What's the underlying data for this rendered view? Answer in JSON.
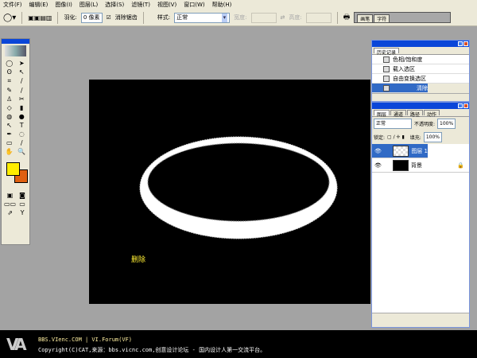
{
  "menu": [
    "文件(F)",
    "编辑(E)",
    "图像(I)",
    "图层(L)",
    "选择(S)",
    "滤镜(T)",
    "视图(V)",
    "窗口(W)",
    "帮助(H)"
  ],
  "options": {
    "feather_label": "羽化:",
    "feather_value": "0 像素",
    "antialias_label": "消除锯齿",
    "style_label": "样式:",
    "style_value": "正常",
    "width_label": "宽度:",
    "height_label": "高度:",
    "well_tabs": [
      "画笔",
      "字符"
    ]
  },
  "toolbox": {
    "tools": [
      "◯",
      "➤",
      "ʘ",
      "↖",
      "⌗",
      "∕",
      "✎",
      "∕",
      "♙",
      "✂",
      "◇",
      "▮",
      "◍",
      "●",
      "↖",
      "T",
      "✒",
      "◌",
      "▭",
      "∕",
      "✋",
      "🔍"
    ],
    "fg_color": "#ffee00",
    "bg_color": "#e06010"
  },
  "canvas": {
    "caption": "删除",
    "caption_color": "#ffee33"
  },
  "history": {
    "tab": "历史记录",
    "items": [
      "色相/饱和度",
      "载入选区",
      "自由变换选区",
      "清除"
    ],
    "selected": 3
  },
  "layers": {
    "tabs": [
      "图层",
      "通道",
      "路径",
      "动作"
    ],
    "blend": "正常",
    "opacity_label": "不透明度:",
    "opacity": "100%",
    "lock_label": "锁定:",
    "fill_label": "填充:",
    "fill": "100%",
    "items": [
      {
        "name": "图层 1",
        "selected": true
      },
      {
        "name": "背景",
        "selected": false
      }
    ]
  },
  "footer": {
    "line1": "BBS.VIenc.COM | VI.Forum(VF)",
    "line2": "Copyright(C)CAT,来源：bbs.vicnc.com,创意设计论坛 - 国内设计人第一交流平台。",
    "logo": "VA"
  },
  "colors": {
    "titlebar": "#0a46d8",
    "selection": "#316ac5"
  }
}
